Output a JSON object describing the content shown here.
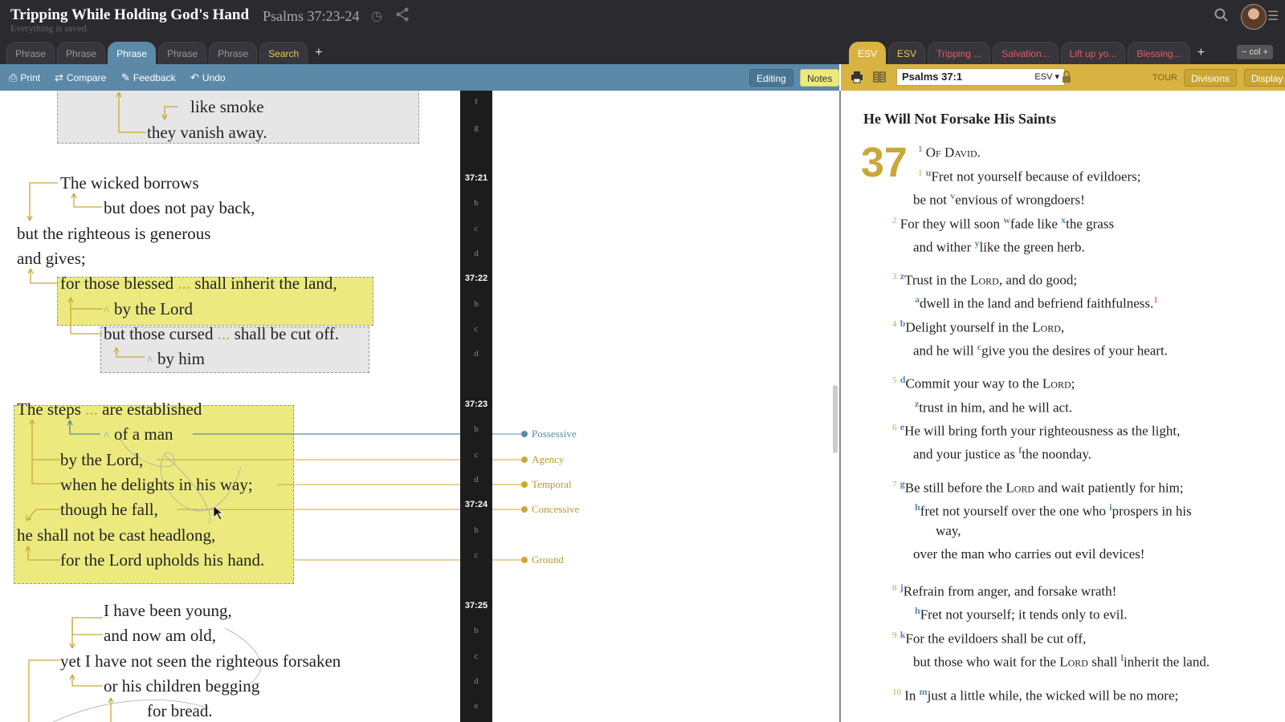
{
  "header": {
    "title": "Tripping While Holding God's Hand",
    "reference": "Psalms 37:23-24",
    "saved_status": "Everything is saved.",
    "icons": [
      "clock-icon",
      "share-icon",
      "search-icon",
      "menu-icon"
    ]
  },
  "left_tabs": [
    "Phrase",
    "Phrase",
    "Phrase",
    "Phrase",
    "Phrase",
    "Search"
  ],
  "left_tab_plus": "+",
  "right_tabs": [
    "ESV",
    "ESV",
    "Tripping ...",
    "Salvation...",
    "Lift up yo...",
    "Blessing..."
  ],
  "right_tab_plus": "+",
  "col_control": "− col +",
  "toolbar": {
    "print": "Print",
    "compare": "Compare",
    "feedback": "Feedback",
    "undo": "Undo",
    "editing": "Editing",
    "notes": "Notes"
  },
  "reader_toolbar": {
    "reference": "Psalms 37:1",
    "version": "ESV ▾",
    "tour": "TOUR",
    "divisions": "Divisions",
    "display": "Display"
  },
  "phrase_lines": [
    "like smoke",
    "they vanish away.",
    "The wicked borrows",
    "but does not pay back,",
    "but the righteous is generous",
    "and gives;",
    "for those blessed",
    "shall inherit the land,",
    "by the Lord",
    "but those cursed",
    "shall be cut off.",
    "by him",
    "The steps",
    "are established",
    "of a man",
    "by the Lord,",
    "when he delights in his way;",
    "though he fall,",
    "he shall not be cast headlong,",
    "for the Lord upholds his hand.",
    "I have been young,",
    "and now am old,",
    "yet I have not seen the righteous forsaken",
    "or his children begging",
    "for bread."
  ],
  "ellipsis": "...",
  "caret": "^",
  "gutter_labels": [
    "f",
    "g",
    "37:21",
    "b",
    "c",
    "d",
    "37:22",
    "b",
    "c",
    "d",
    "37:23",
    "b",
    "c",
    "d",
    "37:24",
    "b",
    "c",
    "37:25",
    "b",
    "c",
    "d",
    "e"
  ],
  "relations": [
    "Possessive",
    "Agency",
    "Temporal",
    "Concessive",
    "Ground"
  ],
  "colors": {
    "blue": "#5b89a7",
    "gold": "#c9a83a",
    "highlight": "#ecea7f"
  },
  "reader": {
    "section_title": "He Will Not Forsake His Saints",
    "chapter": "37",
    "lines": [
      {
        "v": "1",
        "fn": "",
        "text": "Of David."
      },
      {
        "v": "1",
        "fn": "u",
        "text": "Fret not yourself because of evildoers;"
      },
      {
        "v": "",
        "fn": "",
        "text": "be not"
      },
      {
        "v": "",
        "fn": "v",
        "text": "envious of wrongdoers!"
      },
      {
        "v": "2",
        "fn": "",
        "text": "For they will soon"
      },
      {
        "v": "",
        "fn": "w",
        "text": "fade like"
      },
      {
        "v": "",
        "fn": "x",
        "text": "the grass"
      },
      {
        "v": "",
        "fn": "",
        "text": "and wither"
      },
      {
        "v": "",
        "fn": "y",
        "text": "like the green herb."
      },
      {
        "v": "3",
        "fn": "z",
        "text": "Trust in the"
      },
      {
        "v": "",
        "fn": "",
        "text": "Lord"
      },
      {
        "v": "",
        "fn": "",
        "text": ", and do good;"
      },
      {
        "v": "",
        "fn": "a",
        "text": "dwell in the land and befriend faithfulness."
      },
      {
        "v": "",
        "fn": "1",
        "text": ""
      },
      {
        "v": "4",
        "fn": "b",
        "text": "Delight yourself in the"
      },
      {
        "v": "",
        "fn": "",
        "text": "Lord"
      },
      {
        "v": "",
        "fn": "",
        "text": ","
      },
      {
        "v": "",
        "fn": "",
        "text": "and he will"
      },
      {
        "v": "",
        "fn": "c",
        "text": "give you the desires of your heart."
      },
      {
        "v": "5",
        "fn": "d",
        "text": "Commit your way to the"
      },
      {
        "v": "",
        "fn": "",
        "text": "Lord"
      },
      {
        "v": "",
        "fn": "",
        "text": ";"
      },
      {
        "v": "",
        "fn": "z",
        "text": "trust in him, and he will act."
      },
      {
        "v": "6",
        "fn": "e",
        "text": "He will bring forth your righteousness as the light,"
      },
      {
        "v": "",
        "fn": "",
        "text": "and your justice as"
      },
      {
        "v": "",
        "fn": "f",
        "text": "the noonday."
      },
      {
        "v": "7",
        "fn": "g",
        "text": "Be still before the"
      },
      {
        "v": "",
        "fn": "",
        "text": "Lord"
      },
      {
        "v": "",
        "fn": "",
        "text": "and wait patiently for him;"
      },
      {
        "v": "",
        "fn": "h",
        "text": "fret not yourself over the one who"
      },
      {
        "v": "",
        "fn": "i",
        "text": "prospers in his"
      },
      {
        "v": "",
        "fn": "",
        "text": "way,"
      },
      {
        "v": "",
        "fn": "",
        "text": "over the man who carries out evil devices!"
      },
      {
        "v": "8",
        "fn": "j",
        "text": "Refrain from anger, and forsake wrath!"
      },
      {
        "v": "",
        "fn": "h",
        "text": "Fret not yourself; it tends only to evil."
      },
      {
        "v": "9",
        "fn": "k",
        "text": "For the evildoers shall be cut off,"
      },
      {
        "v": "",
        "fn": "",
        "text": "but those who wait for the"
      },
      {
        "v": "",
        "fn": "",
        "text": "Lord"
      },
      {
        "v": "",
        "fn": "",
        "text": "shall"
      },
      {
        "v": "",
        "fn": "l",
        "text": "inherit the land."
      },
      {
        "v": "10",
        "fn": "",
        "text": "In"
      },
      {
        "v": "",
        "fn": "m",
        "text": "just a little while, the wicked will be no more;"
      }
    ]
  }
}
